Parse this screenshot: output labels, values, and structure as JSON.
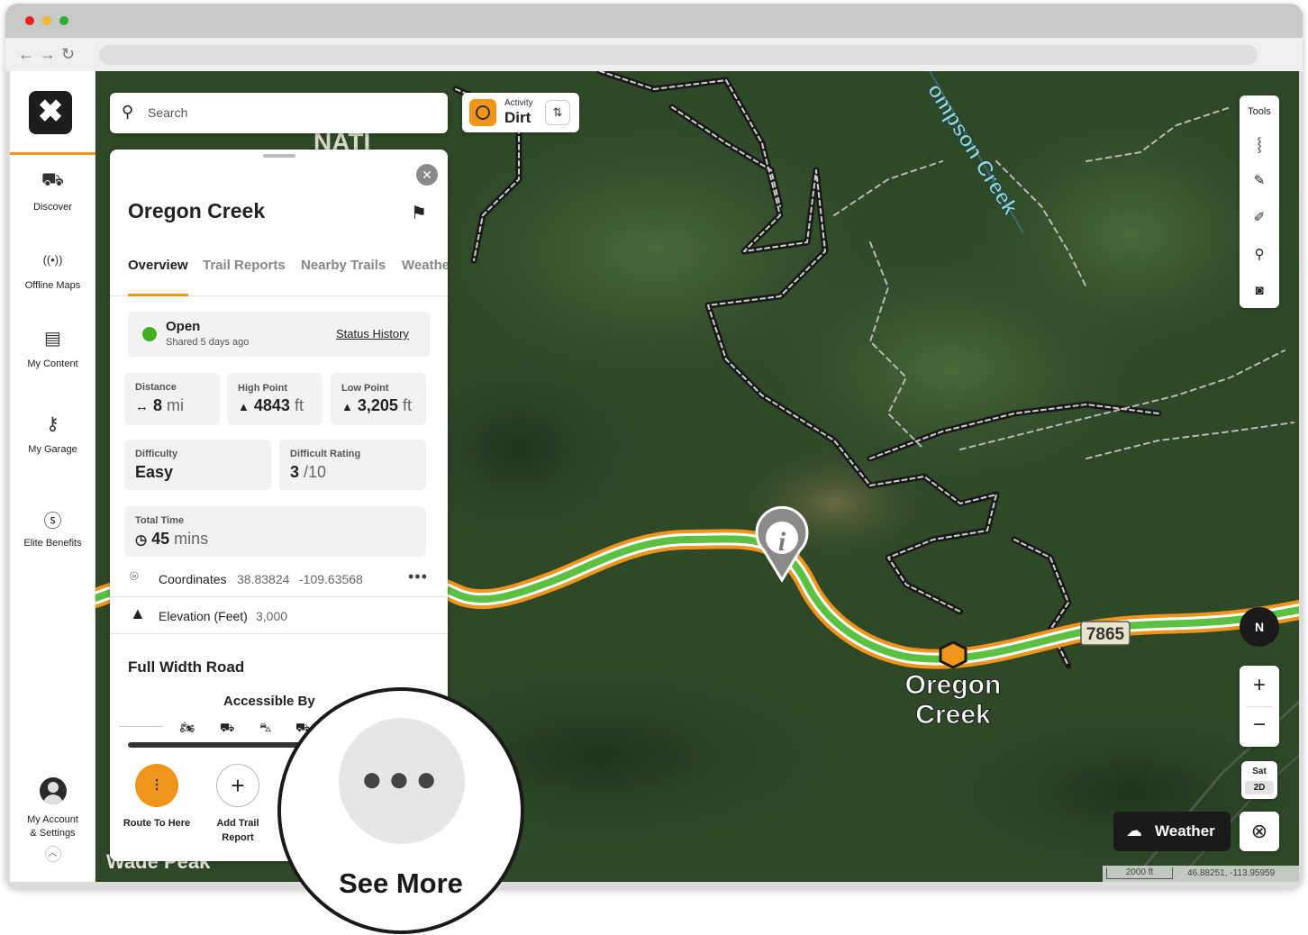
{
  "sidebar": {
    "logo": "✖",
    "items": [
      {
        "label": "Discover",
        "icon": "jeep-icon"
      },
      {
        "label": "Offline Maps",
        "icon": "broadcast-icon"
      },
      {
        "label": "My Content",
        "icon": "folder-icon"
      },
      {
        "label": "My Garage",
        "icon": "keys-icon"
      },
      {
        "label": "Elite Benefits",
        "icon": "dollar-icon"
      }
    ],
    "account": {
      "line1": "My Account",
      "line2": "& Settings"
    }
  },
  "search": {
    "placeholder": "Search"
  },
  "activity": {
    "small": "Activity",
    "value": "Dirt"
  },
  "panel": {
    "title": "Oregon Creek",
    "tabs": [
      "Overview",
      "Trail Reports",
      "Nearby Trails",
      "Weathe"
    ],
    "status": {
      "label": "Open",
      "sub": "Shared 5 days ago",
      "link": "Status History",
      "color": "#43b020"
    },
    "stats": {
      "distance": {
        "label": "Distance",
        "value": "8",
        "unit": "mi"
      },
      "high": {
        "label": "High Point",
        "value": "4843",
        "unit": "ft"
      },
      "low": {
        "label": "Low Point",
        "value": "3,205",
        "unit": "ft"
      },
      "difficulty": {
        "label": "Difficulty",
        "value": "Easy"
      },
      "rating": {
        "label": "Difficult Rating",
        "value": "3",
        "unit": "/10"
      },
      "time": {
        "label": "Total Time",
        "value": "45",
        "unit": "mins"
      }
    },
    "coordinates": {
      "label": "Coordinates",
      "lat": "38.83824",
      "lon": "-109.63568"
    },
    "elevation": {
      "label": "Elevation (Feet)",
      "value": "3,000"
    },
    "road_type": "Full Width Road",
    "accessible_title": "Accessible By",
    "actions": [
      {
        "label": "Route To Here"
      },
      {
        "label1": "Add Trail",
        "label2": "Report"
      }
    ]
  },
  "map": {
    "labels": {
      "nati": "NATI",
      "creek_name": "ompson Creek",
      "trail_line1": "Oregon",
      "trail_line2": "Creek",
      "route_number": "7865",
      "peak": "Wade Peak"
    },
    "colors": {
      "trail_orange": "#f0941b",
      "trail_green": "#5cc142",
      "forest": "#2f4a2a"
    }
  },
  "tools": {
    "title": "Tools"
  },
  "compass": {
    "label": "N"
  },
  "layer": {
    "label": "Sat",
    "mode": "2D"
  },
  "weather": {
    "label": "Weather"
  },
  "scale": {
    "distance": "2000 ft",
    "coords": "46.88251, -113.95959"
  },
  "callout": {
    "label": "See More"
  }
}
